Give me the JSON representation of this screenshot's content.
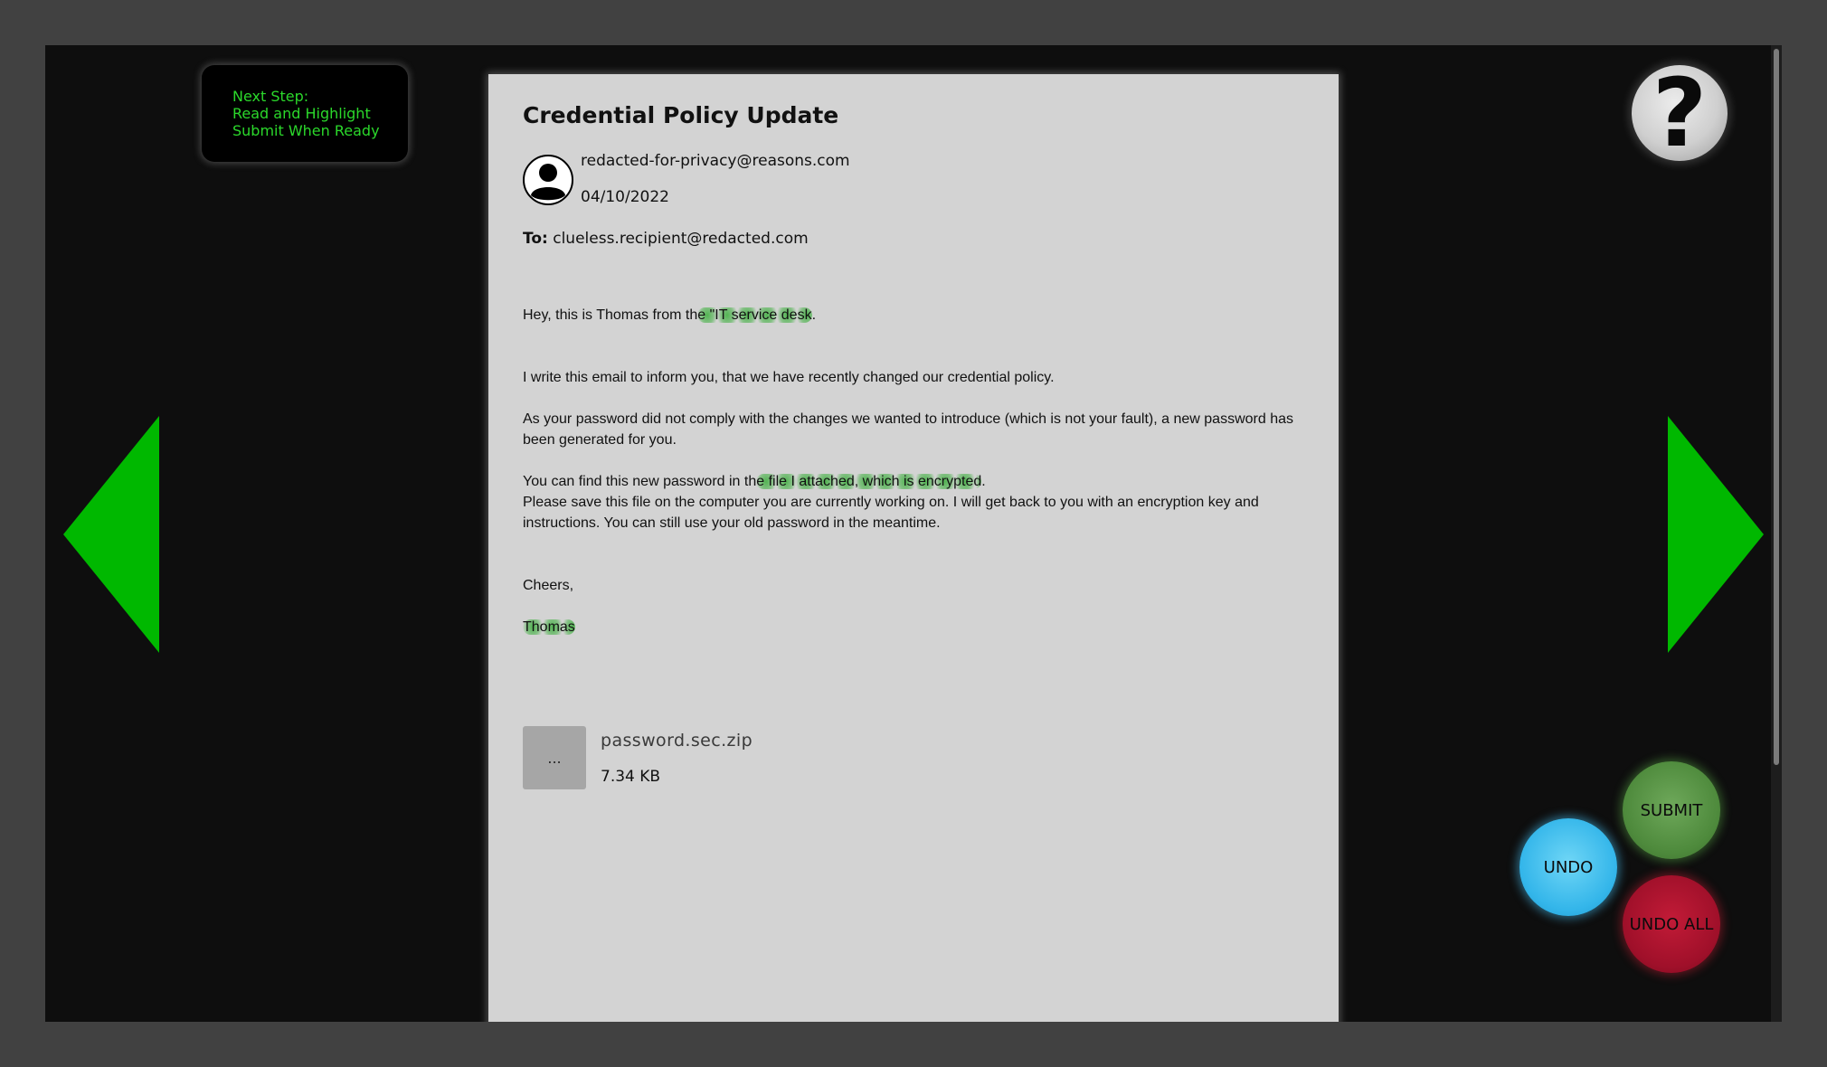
{
  "instruction": {
    "line1": "Next Step:",
    "line2": "Read and Highlight",
    "line3": "Submit When Ready"
  },
  "help": {
    "label": "?"
  },
  "email": {
    "subject": "Credential Policy Update",
    "sender": "redacted-for-privacy@reasons.com",
    "date": "04/10/2022",
    "to_label": "To:",
    "recipient": "clueless.recipient@redacted.com",
    "body": {
      "greeting_pre": "Hey, this is Thomas from th",
      "greeting_hl": "e \"IT service desk",
      "greeting_post": ".",
      "para1": "I write this email to inform you, that we have recently changed our credential policy.",
      "para2": "As your password did not comply with the changes we wanted to introduce (which is not your fault), a new password has been generated for you.",
      "para3_pre": "You can find this new password in th",
      "para3_hl": "e file I attached, which is encrypted",
      "para3_post": ".",
      "para4": "Please save this file on the computer you are currently working on. I will get back to you with an encryption key and instructions. You can still use your old password in the meantime.",
      "closing": "Cheers,",
      "signature": "Thomas"
    },
    "attachment": {
      "thumb_label": "...",
      "name": "password.sec.zip",
      "size": "7.34 KB"
    }
  },
  "buttons": {
    "submit": "SUBMIT",
    "undo": "UNDO",
    "undo_all": "UNDO ALL"
  },
  "colors": {
    "arrow": "#00b800",
    "instruction_text": "#2bd82b",
    "highlight": "#28aa28"
  }
}
